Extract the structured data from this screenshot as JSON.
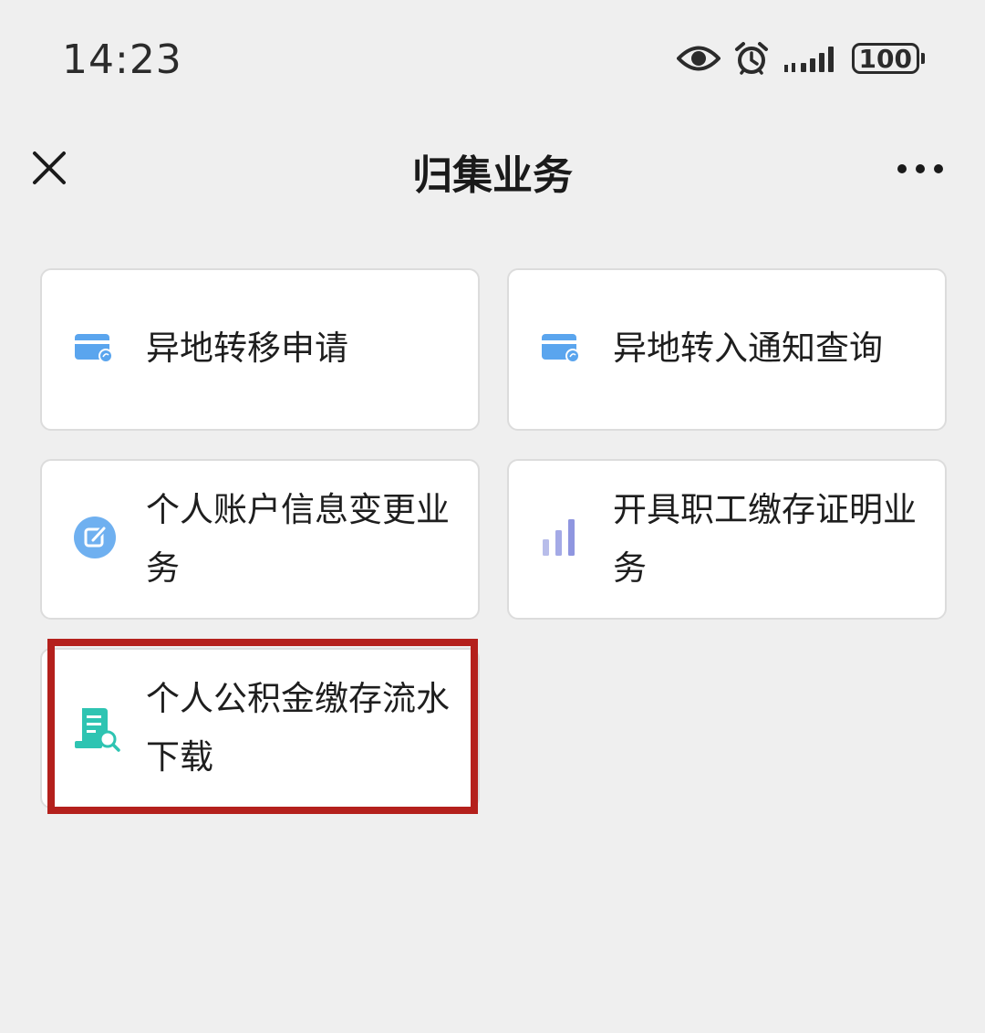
{
  "status_bar": {
    "time": "14:23",
    "battery": "100",
    "icons": [
      "eye-icon",
      "alarm-icon",
      "signal-icon",
      "battery-icon"
    ]
  },
  "nav": {
    "title": "归集业务",
    "close_icon": "close-icon",
    "more_icon": "more-icon"
  },
  "services": [
    {
      "label": "异地转移申请",
      "icon": "card-icon",
      "icon_color": "#5aa5ee"
    },
    {
      "label": "异地转入通知查询",
      "icon": "card-icon",
      "icon_color": "#5aa5ee"
    },
    {
      "label": "个人账户信息变更业务",
      "icon": "edit-icon",
      "icon_color": "#6fb0f0"
    },
    {
      "label": "开具职工缴存证明业务",
      "icon": "bar-chart-icon",
      "icon_color": "#9ea4e4"
    },
    {
      "label": "个人公积金缴存流水下载",
      "icon": "receipt-search-icon",
      "icon_color": "#2ec4b2"
    }
  ],
  "highlight_color": "#b4201c"
}
